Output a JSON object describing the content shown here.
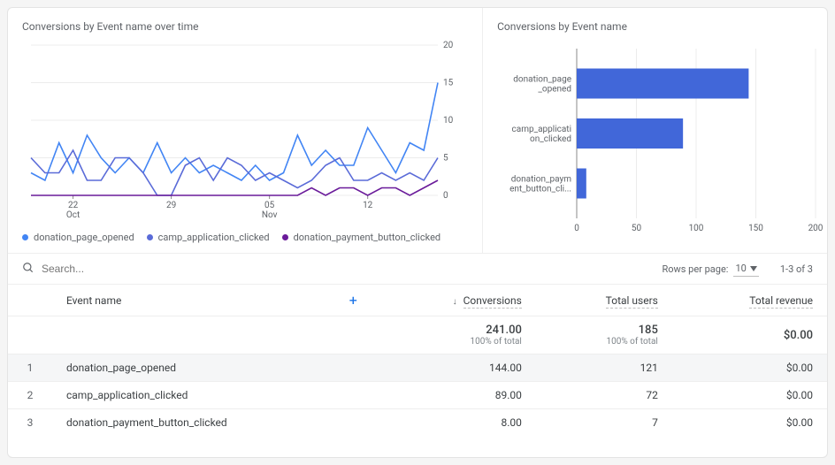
{
  "charts": {
    "line": {
      "title": "Conversions by Event name over time",
      "series": [
        {
          "name": "donation_page_opened",
          "color": "#4285f4"
        },
        {
          "name": "camp_application_clicked",
          "color": "#5a6bd8"
        },
        {
          "name": "donation_payment_button_clicked",
          "color": "#6a1b9a"
        }
      ],
      "ylim": [
        0,
        20
      ],
      "yticks": [
        0,
        5,
        10,
        15,
        20
      ],
      "xticks": [
        {
          "major": "22",
          "minor": "Oct"
        },
        {
          "major": "29",
          "minor": ""
        },
        {
          "major": "05",
          "minor": "Nov"
        },
        {
          "major": "12",
          "minor": ""
        }
      ]
    },
    "bar": {
      "title": "Conversions by Event name",
      "categories": [
        "donation_page_opened",
        "camp_application_clicked",
        "donation_payment_button_cli..."
      ],
      "category_labels": [
        [
          "donation_page",
          "_opened"
        ],
        [
          "camp_applicati",
          "on_clicked"
        ],
        [
          "donation_paym",
          "ent_button_cli..."
        ]
      ],
      "values": [
        144,
        89,
        8
      ],
      "xlim": [
        0,
        200
      ],
      "xticks": [
        0,
        50,
        100,
        150,
        200
      ],
      "color": "#4167d9"
    }
  },
  "chart_data": [
    {
      "type": "line",
      "title": "Conversions by Event name over time",
      "xlabel": "",
      "ylabel": "",
      "ylim": [
        0,
        20
      ],
      "x": [
        "Oct 19",
        "Oct 20",
        "Oct 21",
        "Oct 22",
        "Oct 23",
        "Oct 24",
        "Oct 25",
        "Oct 26",
        "Oct 27",
        "Oct 28",
        "Oct 29",
        "Oct 30",
        "Oct 31",
        "Nov 01",
        "Nov 02",
        "Nov 03",
        "Nov 04",
        "Nov 05",
        "Nov 06",
        "Nov 07",
        "Nov 08",
        "Nov 09",
        "Nov 10",
        "Nov 11",
        "Nov 12",
        "Nov 13",
        "Nov 14",
        "Nov 15",
        "Nov 16",
        "Nov 17"
      ],
      "series": [
        {
          "name": "donation_page_opened",
          "values": [
            3,
            2,
            7,
            3,
            8,
            5,
            3,
            5,
            3,
            7,
            3,
            5,
            3,
            4,
            3,
            2,
            4,
            2,
            3,
            8,
            4,
            6,
            4,
            4,
            9,
            6,
            3,
            7,
            6,
            15
          ]
        },
        {
          "name": "camp_application_clicked",
          "values": [
            5,
            3,
            3,
            6,
            2,
            2,
            5,
            5,
            3,
            0,
            0,
            4,
            5,
            2,
            5,
            4,
            2,
            3,
            2,
            1,
            2,
            4,
            5,
            2,
            2,
            3,
            2,
            3,
            2,
            5
          ]
        },
        {
          "name": "donation_payment_button_clicked",
          "values": [
            0,
            0,
            0,
            0,
            0,
            0,
            0,
            0,
            0,
            0,
            0,
            0,
            0,
            0,
            0,
            0,
            0,
            0,
            0,
            0,
            1,
            0,
            1,
            1,
            0,
            1,
            1,
            0,
            1,
            2
          ]
        }
      ]
    },
    {
      "type": "bar",
      "title": "Conversions by Event name",
      "xlabel": "",
      "ylabel": "",
      "xlim": [
        0,
        200
      ],
      "orientation": "horizontal",
      "categories": [
        "donation_page_opened",
        "camp_application_clicked",
        "donation_payment_button_clicked"
      ],
      "values": [
        144,
        89,
        8
      ]
    }
  ],
  "toolbar": {
    "search_placeholder": "Search...",
    "rows_per_page_label": "Rows per page:",
    "rows_per_page_value": "10",
    "page_range": "1-3 of 3"
  },
  "table": {
    "headers": {
      "event_name": "Event name",
      "conversions": "Conversions",
      "total_users": "Total users",
      "total_revenue": "Total revenue"
    },
    "totals": {
      "conversions": "241.00",
      "conversions_sub": "100% of total",
      "total_users": "185",
      "total_users_sub": "100% of total",
      "total_revenue": "$0.00"
    },
    "rows": [
      {
        "idx": "1",
        "name": "donation_page_opened",
        "conversions": "144.00",
        "users": "121",
        "revenue": "$0.00"
      },
      {
        "idx": "2",
        "name": "camp_application_clicked",
        "conversions": "89.00",
        "users": "72",
        "revenue": "$0.00"
      },
      {
        "idx": "3",
        "name": "donation_payment_button_clicked",
        "conversions": "8.00",
        "users": "7",
        "revenue": "$0.00"
      }
    ]
  }
}
